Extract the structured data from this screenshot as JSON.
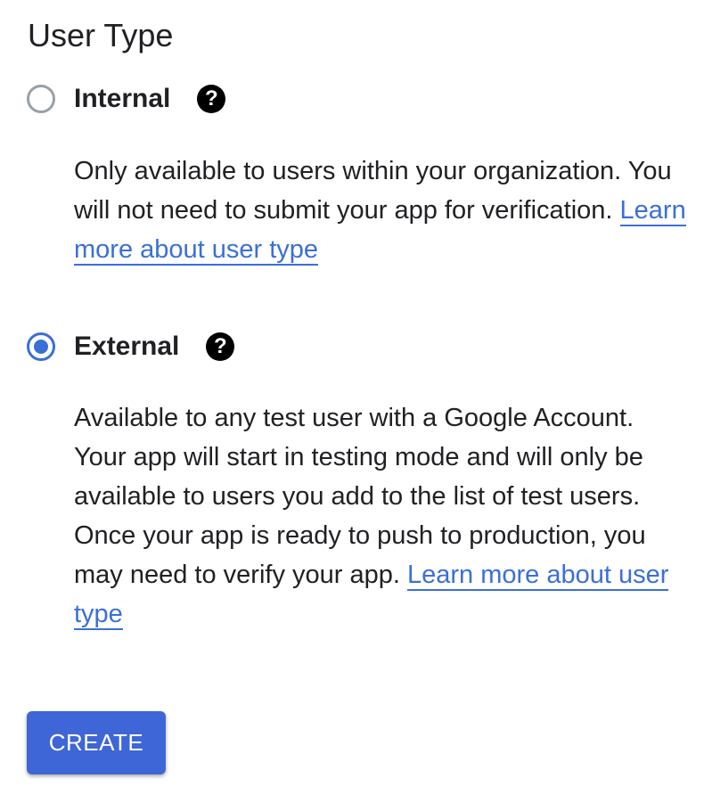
{
  "user_type": {
    "title": "User Type",
    "options": [
      {
        "label": "Internal",
        "selected": false,
        "help_icon": "help-circle-icon",
        "description": "Only available to users within your organization. You will not need to submit your app for verification.",
        "link_text": "Learn more about user type"
      },
      {
        "label": "External",
        "selected": true,
        "help_icon": "help-circle-icon",
        "description": "Available to any test user with a Google Account. Your app will start in testing mode and will only be available to users you add to the list of test users. Once your app is ready to push to production, you may need to verify your app.",
        "link_text": "Learn more about user type"
      }
    ],
    "help_glyph": "?"
  },
  "actions": {
    "create_label": "CREATE"
  },
  "colors": {
    "accent": "#3b6fd8",
    "button_bg": "#3f66d6",
    "radio_unselected": "#9aa0a6",
    "text": "#202124"
  }
}
